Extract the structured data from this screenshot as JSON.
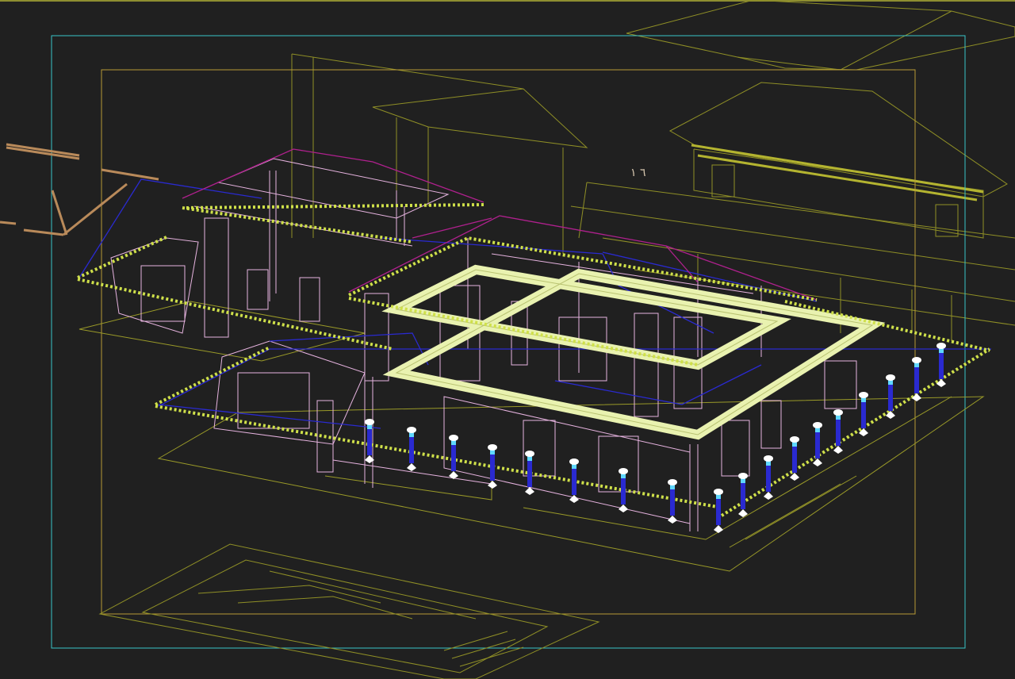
{
  "viewport": {
    "background": "#202020",
    "colors": {
      "scene_lines": "#a8a82a",
      "safe_frame_outer": "#38c4c8",
      "safe_frame_inner": "#b89a36",
      "pink_wire": "#e6b3df",
      "magenta_wire": "#b0208e",
      "blue_wire": "#2a2ad0",
      "highlight_frame": "#e9f2b0",
      "column_cap": "#ffffff",
      "column_glow": "#5fd8ff",
      "beam_brown": "#b98a5a"
    },
    "gizmo_label": "٦ ١"
  }
}
